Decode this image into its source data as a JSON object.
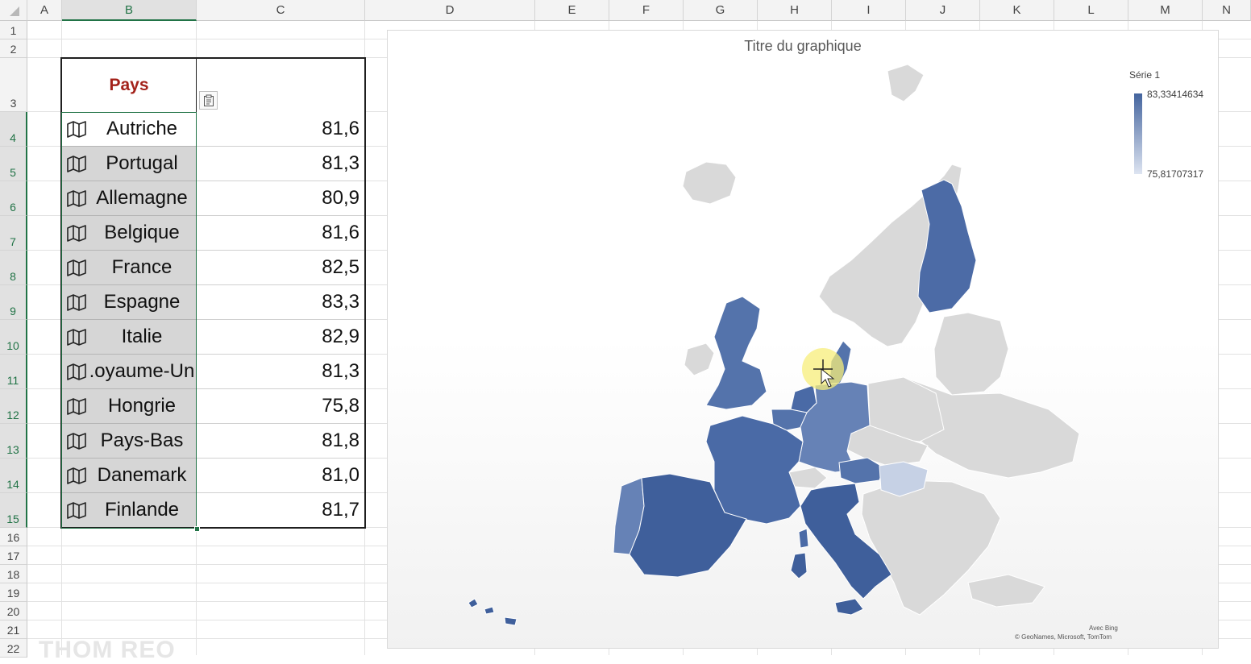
{
  "columns": [
    "A",
    "B",
    "C",
    "D",
    "E",
    "F",
    "G",
    "H",
    "I",
    "J",
    "K",
    "L",
    "M",
    "N"
  ],
  "rows": [
    "1",
    "2",
    "3",
    "4",
    "5",
    "6",
    "7",
    "8",
    "9",
    "10",
    "11",
    "12",
    "13",
    "14",
    "15",
    "16",
    "17",
    "18",
    "19",
    "20",
    "21",
    "22"
  ],
  "table": {
    "header": "Pays",
    "rows": [
      {
        "country": "Autriche",
        "value": "81,6"
      },
      {
        "country": "Portugal",
        "value": "81,3"
      },
      {
        "country": "Allemagne",
        "value": "80,9"
      },
      {
        "country": "Belgique",
        "value": "81,6"
      },
      {
        "country": "France",
        "value": "82,5"
      },
      {
        "country": "Espagne",
        "value": "83,3"
      },
      {
        "country": "Italie",
        "value": "82,9"
      },
      {
        "country": ".oyaume-Un",
        "value": "81,3"
      },
      {
        "country": "Hongrie",
        "value": "75,8"
      },
      {
        "country": "Pays-Bas",
        "value": "81,8"
      },
      {
        "country": "Danemark",
        "value": "81,0"
      },
      {
        "country": "Finlande",
        "value": "81,7"
      }
    ]
  },
  "chart": {
    "title": "Titre du graphique",
    "legend_title": "Série 1",
    "legend_max": "83,33414634",
    "legend_min": "75,81707317",
    "attribution_1": "Avec Bing",
    "attribution_2": "© GeoNames, Microsoft, TomTom"
  },
  "chart_data": {
    "type": "map",
    "title": "Titre du graphique",
    "series": [
      {
        "name": "Série 1",
        "values": [
          81.6,
          81.3,
          80.9,
          81.6,
          82.5,
          83.3,
          82.9,
          81.3,
          75.8,
          81.8,
          81.0,
          81.7
        ]
      }
    ],
    "categories": [
      "Autriche",
      "Portugal",
      "Allemagne",
      "Belgique",
      "France",
      "Espagne",
      "Italie",
      "Royaume-Uni",
      "Hongrie",
      "Pays-Bas",
      "Danemark",
      "Finlande"
    ],
    "legend_range": [
      75.81707317,
      83.33414634
    ],
    "colors": {
      "high": "#3f5f9b",
      "low": "#dde4f1",
      "no_data": "#d9d9d9"
    }
  },
  "watermark": "THOM REO"
}
